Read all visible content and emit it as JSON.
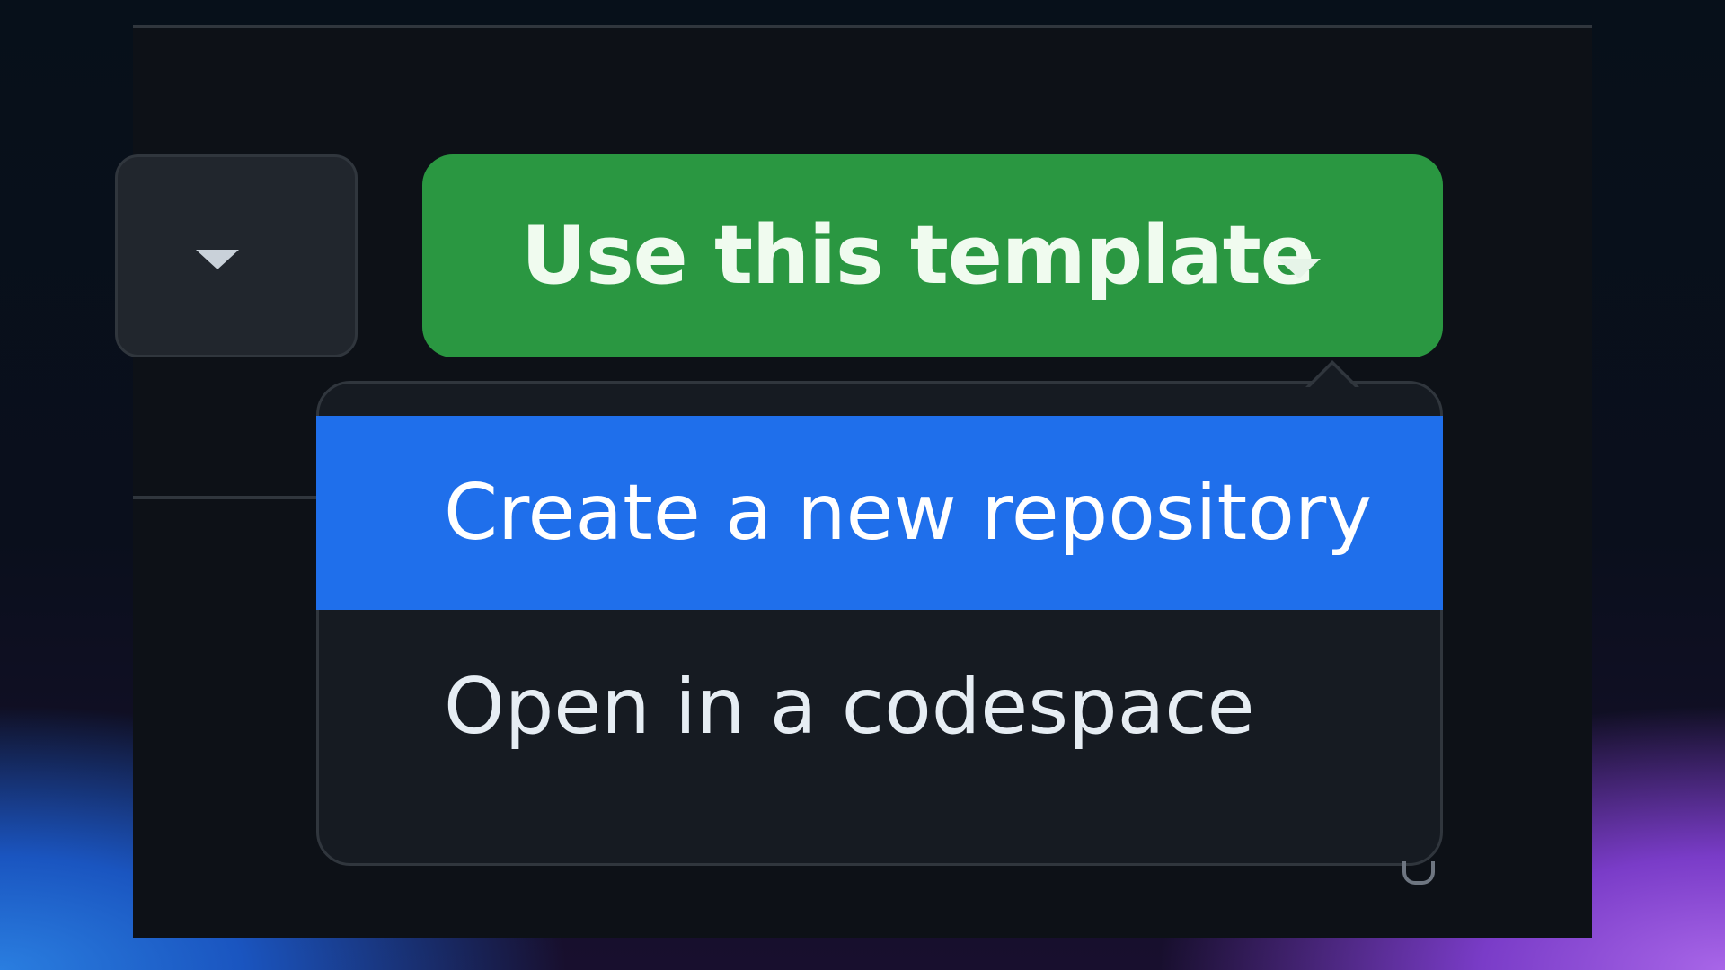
{
  "toolbar": {
    "secondary_button_icon": "chevron-down-icon",
    "primary_button": {
      "label": "Use this template",
      "icon": "chevron-down-icon",
      "color": "#2a9741"
    }
  },
  "template_menu": {
    "items": [
      {
        "label": "Create a new repository",
        "active": true
      },
      {
        "label": "Open in a codespace",
        "active": false
      }
    ],
    "active_color": "#1f6feb"
  }
}
